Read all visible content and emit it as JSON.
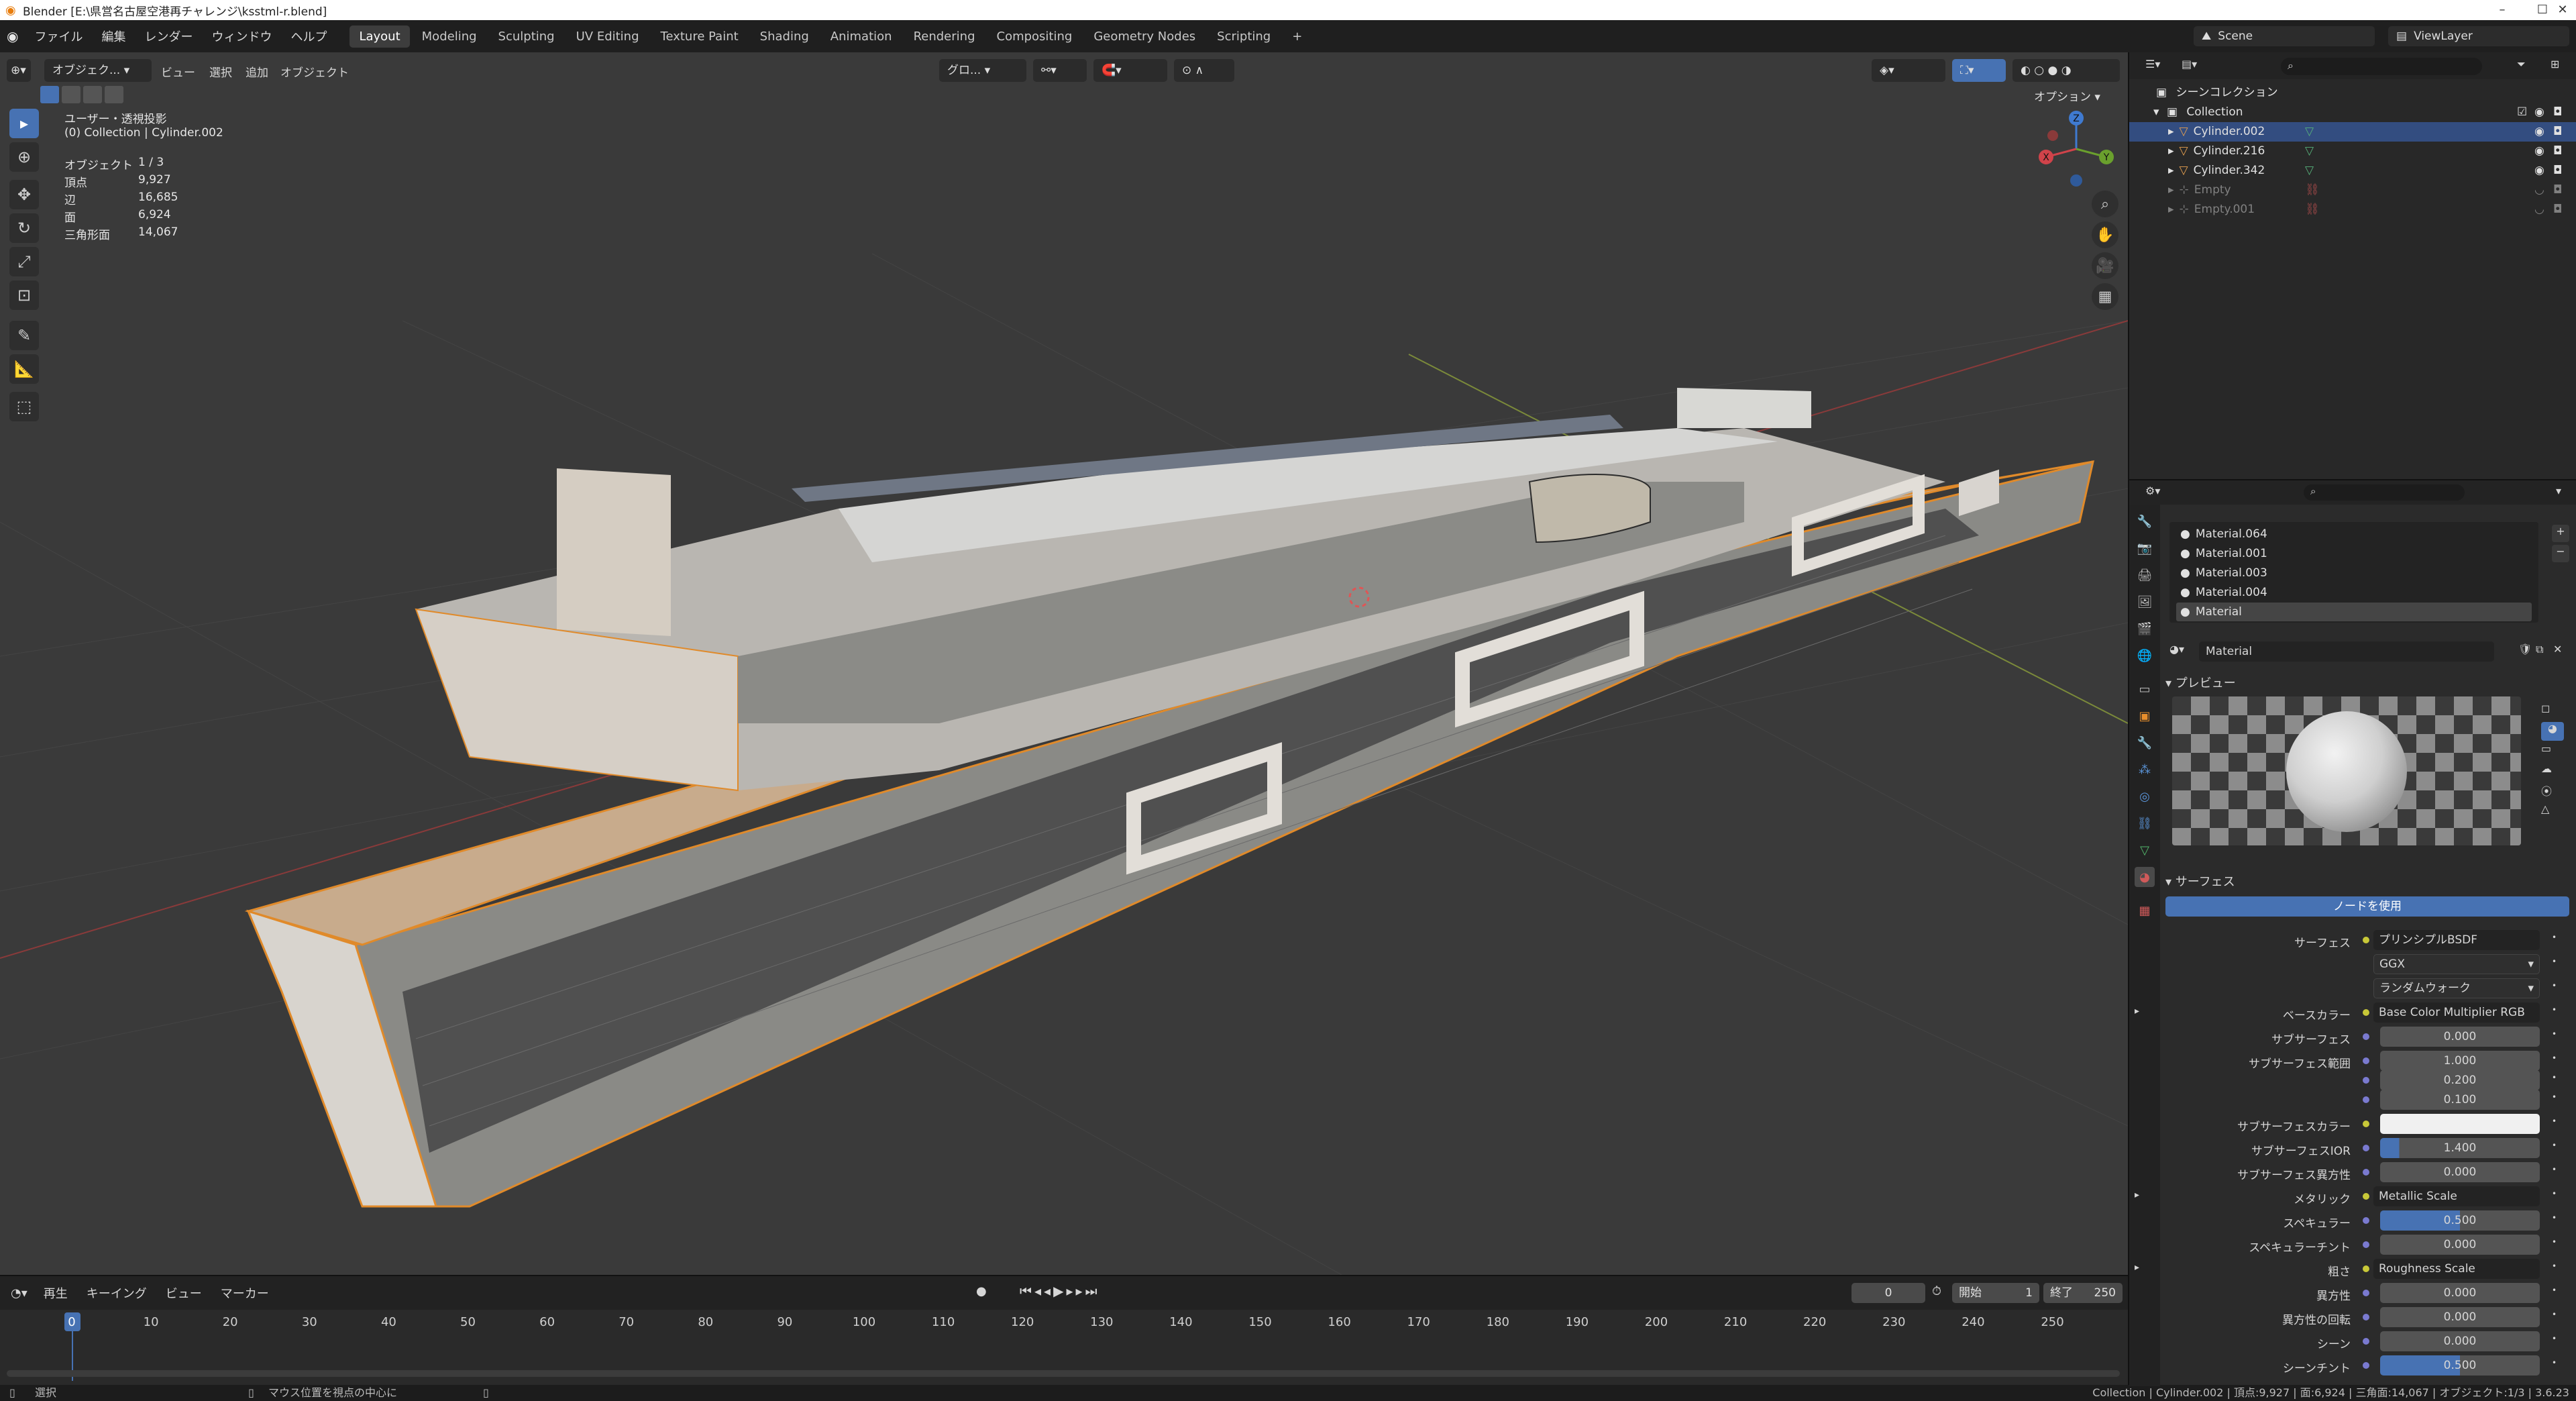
{
  "window": {
    "title": "Blender [E:\\県営名古屋空港再チャレンジ\\ksstml-r.blend]",
    "controls": [
      "–",
      "☐",
      "✕"
    ]
  },
  "topbar": {
    "menus": [
      "ファイル",
      "編集",
      "レンダー",
      "ウィンドウ",
      "ヘルプ"
    ],
    "workspaces": [
      "Layout",
      "Modeling",
      "Sculpting",
      "UV Editing",
      "Texture Paint",
      "Shading",
      "Animation",
      "Rendering",
      "Compositing",
      "Geometry Nodes",
      "Scripting"
    ],
    "active_workspace": "Layout",
    "add_tab": "+",
    "scene": "Scene",
    "view_layer": "ViewLayer"
  },
  "viewport": {
    "mode": "オブジェク...",
    "menus": [
      "ビュー",
      "選択",
      "追加",
      "オブジェクト"
    ],
    "transform_orientation": "グロ...",
    "options_label": "オプション",
    "view_name": "ユーザー・透視投影",
    "collection_line": "(0) Collection | Cylinder.002",
    "stats": [
      {
        "k": "オブジェクト",
        "v": "1 / 3"
      },
      {
        "k": "頂点",
        "v": "9,927"
      },
      {
        "k": "辺",
        "v": "16,685"
      },
      {
        "k": "面",
        "v": "6,924"
      },
      {
        "k": "三角形面",
        "v": "14,067"
      }
    ],
    "gizmo": {
      "x": "X",
      "y": "Y",
      "z": "Z"
    }
  },
  "timeline": {
    "menus": [
      "再生",
      "キーイング",
      "ビュー",
      "マーカー"
    ],
    "current_frame": "0",
    "start_label": "開始",
    "start": "1",
    "end_label": "終了",
    "end": "250",
    "frame_labels": [
      "0",
      "10",
      "20",
      "30",
      "40",
      "50",
      "60",
      "70",
      "80",
      "90",
      "100",
      "110",
      "120",
      "130",
      "140",
      "150",
      "160",
      "170",
      "180",
      "190",
      "200",
      "210",
      "220",
      "230",
      "240",
      "250"
    ]
  },
  "statusbar": {
    "left": "選択",
    "middle": "マウス位置を視点の中心に",
    "right": "Collection | Cylinder.002 | 頂点:9,927 | 面:6,924 | 三角面:14,067 | オブジェクト:1/3 | 3.6.23"
  },
  "outliner": {
    "root": "シーンコレクション",
    "collection": "Collection",
    "items": [
      {
        "name": "Cylinder.002",
        "selected": true,
        "dim": false
      },
      {
        "name": "Cylinder.216",
        "selected": false,
        "dim": false
      },
      {
        "name": "Cylinder.342",
        "selected": false,
        "dim": false
      },
      {
        "name": "Empty",
        "selected": false,
        "dim": true
      },
      {
        "name": "Empty.001",
        "selected": false,
        "dim": true
      }
    ]
  },
  "properties": {
    "materials": [
      "Material.064",
      "Material.001",
      "Material.003",
      "Material.004",
      "Material"
    ],
    "active_material": "Material",
    "preview_label": "プレビュー",
    "surface_label": "サーフェス",
    "use_nodes": "ノードを使用",
    "rows": [
      {
        "label": "サーフェス",
        "value": "プリンシプルBSDF",
        "kind": "link"
      },
      {
        "label": "",
        "value": "GGX",
        "kind": "dropdown"
      },
      {
        "label": "",
        "value": "ランダムウォーク",
        "kind": "dropdown"
      },
      {
        "label": "ベースカラー",
        "value": "Base Color Multiplier RGB",
        "kind": "link"
      },
      {
        "label": "サブサーフェス",
        "value": "0.000",
        "kind": "num"
      },
      {
        "label": "サブサーフェス範囲",
        "value": "1.000",
        "kind": "num"
      },
      {
        "label": "",
        "value": "0.200",
        "kind": "num"
      },
      {
        "label": "",
        "value": "0.100",
        "kind": "num"
      },
      {
        "label": "サブサーフェスカラー",
        "value": "",
        "kind": "color"
      },
      {
        "label": "サブサーフェスIOR",
        "value": "1.400",
        "kind": "num"
      },
      {
        "label": "サブサーフェス異方性",
        "value": "0.000",
        "kind": "num"
      },
      {
        "label": "メタリック",
        "value": "Metallic Scale",
        "kind": "link"
      },
      {
        "label": "スペキュラー",
        "value": "0.500",
        "kind": "slider"
      },
      {
        "label": "スペキュラーチント",
        "value": "0.000",
        "kind": "num"
      },
      {
        "label": "粗さ",
        "value": "Roughness Scale",
        "kind": "link"
      },
      {
        "label": "異方性",
        "value": "0.000",
        "kind": "num"
      },
      {
        "label": "異方性の回転",
        "value": "0.000",
        "kind": "num"
      },
      {
        "label": "シーン",
        "value": "0.000",
        "kind": "num"
      },
      {
        "label": "シーンチント",
        "value": "0.500",
        "kind": "slider"
      }
    ]
  }
}
